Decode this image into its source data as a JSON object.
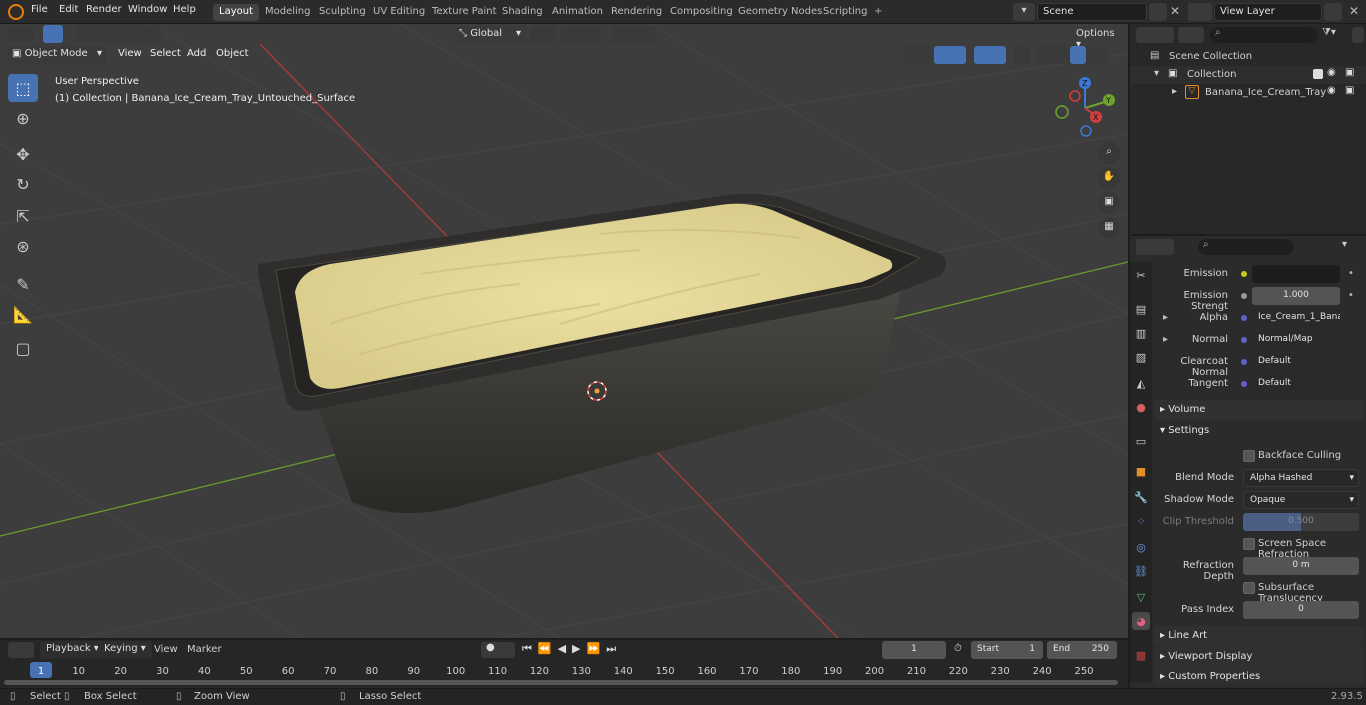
{
  "menus": [
    "File",
    "Edit",
    "Render",
    "Window",
    "Help"
  ],
  "workspaces": [
    "Layout",
    "Modeling",
    "Sculpting",
    "UV Editing",
    "Texture Paint",
    "Shading",
    "Animation",
    "Rendering",
    "Compositing",
    "Geometry Nodes",
    "Scripting"
  ],
  "scene_field": "Scene",
  "view_layer_field": "View Layer",
  "viewport": {
    "mode": "Object Mode",
    "menus": [
      "View",
      "Select",
      "Add",
      "Object"
    ],
    "transform_orientation": "Global",
    "options": "Options",
    "perspective_label": "User Perspective",
    "object_label": "(1) Collection | Banana_Ice_Cream_Tray_Untouched_Surface",
    "gizmo_axes": {
      "x": "X",
      "y": "Y",
      "z": "Z"
    }
  },
  "outliner": {
    "scene_collection": "Scene Collection",
    "collection": "Collection",
    "object": "Banana_Ice_Cream_Tray"
  },
  "properties": {
    "rows": [
      {
        "label": "Emission",
        "value": "",
        "dark": true,
        "socket": "#c8c820"
      },
      {
        "label": "Emission Strengt",
        "value": "1.000",
        "socket": "#9a9a9a",
        "center": true
      },
      {
        "label": "Alpha",
        "value": "Ice_Cream_1_Bana...",
        "socket": "#6363c7",
        "expand": true
      },
      {
        "label": "Normal",
        "value": "Normal/Map",
        "socket": "#6363c7",
        "expand": true
      },
      {
        "label": "Clearcoat Normal",
        "value": "Default",
        "socket": "#6363c7"
      },
      {
        "label": "Tangent",
        "value": "Default",
        "socket": "#6363c7"
      }
    ],
    "volume": "Volume",
    "settings": "Settings",
    "backface_culling": "Backface Culling",
    "blend_mode_label": "Blend Mode",
    "blend_mode": "Alpha Hashed",
    "shadow_mode_label": "Shadow Mode",
    "shadow_mode": "Opaque",
    "clip_threshold_label": "Clip Threshold",
    "clip_threshold": "0.500",
    "ssr": "Screen Space Refraction",
    "refraction_depth_label": "Refraction Depth",
    "refraction_depth": "0 m",
    "subsurface": "Subsurface Translucency",
    "pass_index_label": "Pass Index",
    "pass_index": "0",
    "line_art": "Line Art",
    "viewport_display": "Viewport Display",
    "custom_properties": "Custom Properties"
  },
  "timeline": {
    "menus": [
      "Playback",
      "Keying",
      "View",
      "Marker"
    ],
    "current_frame": "1",
    "start_label": "Start",
    "start": "1",
    "end_label": "End",
    "end": "250",
    "ruler": [
      "1",
      "10",
      "20",
      "30",
      "40",
      "50",
      "60",
      "70",
      "80",
      "90",
      "100",
      "110",
      "120",
      "130",
      "140",
      "150",
      "160",
      "170",
      "180",
      "190",
      "200",
      "210",
      "220",
      "230",
      "240",
      "250"
    ]
  },
  "status": {
    "select": "Select",
    "box_select": "Box Select",
    "zoom_view": "Zoom View",
    "lasso_select": "Lasso Select",
    "version": "2.93.5"
  }
}
